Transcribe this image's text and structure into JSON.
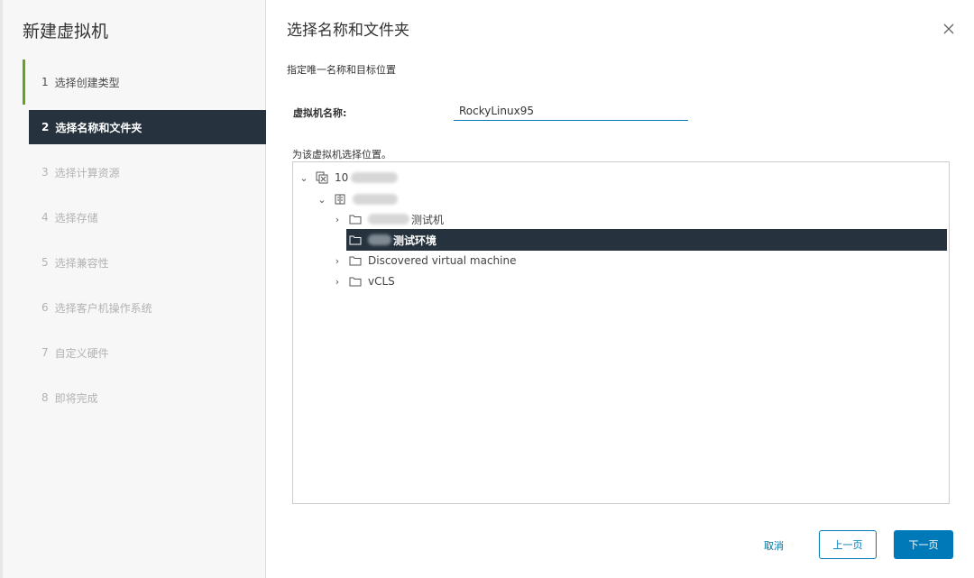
{
  "wizard": {
    "title": "新建虚拟机",
    "steps": [
      {
        "num": "1",
        "label": "选择创建类型",
        "state": "done"
      },
      {
        "num": "2",
        "label": "选择名称和文件夹",
        "state": "active"
      },
      {
        "num": "3",
        "label": "选择计算资源",
        "state": "pending"
      },
      {
        "num": "4",
        "label": "选择存储",
        "state": "pending"
      },
      {
        "num": "5",
        "label": "选择兼容性",
        "state": "pending"
      },
      {
        "num": "6",
        "label": "选择客户机操作系统",
        "state": "pending"
      },
      {
        "num": "7",
        "label": "自定义硬件",
        "state": "pending"
      },
      {
        "num": "8",
        "label": "即将完成",
        "state": "pending"
      }
    ]
  },
  "page": {
    "title": "选择名称和文件夹",
    "subtitle": "指定唯一名称和目标位置",
    "vm_name_label": "虚拟机名称:",
    "vm_name_value": "RockyLinux95",
    "location_label": "为该虚拟机选择位置。"
  },
  "tree": {
    "vcenter": {
      "label": "10",
      "icon": "vcenter-icon",
      "expanded": true
    },
    "datacenter": {
      "label": "",
      "icon": "datacenter-icon",
      "expanded": true
    },
    "folders": [
      {
        "label": "测试机",
        "icon": "folder-icon",
        "selected": false
      },
      {
        "label": "测试环境",
        "icon": "folder-icon",
        "selected": true
      },
      {
        "label": "Discovered virtual machine",
        "icon": "folder-icon",
        "selected": false
      },
      {
        "label": "vCLS",
        "icon": "folder-icon",
        "selected": false
      }
    ]
  },
  "footer": {
    "cancel_label": "取消",
    "prev_label": "上一页",
    "next_label": "下一页"
  },
  "colors": {
    "accent": "#0079b8",
    "selected_bg": "#26333e",
    "done_marker": "#62a420"
  },
  "icons": {
    "close": "close-icon",
    "chevron_down": "chevron-down-icon",
    "chevron_right": "chevron-right-icon"
  }
}
